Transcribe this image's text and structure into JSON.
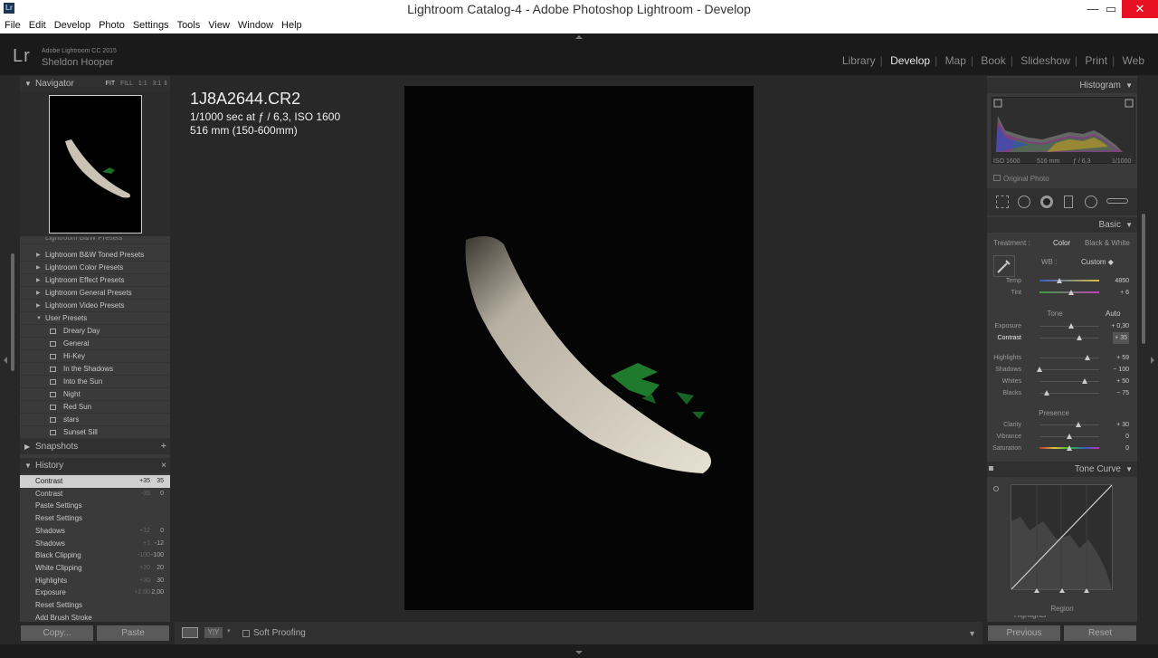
{
  "window": {
    "title": "Lightroom Catalog-4 - Adobe Photoshop Lightroom - Develop",
    "app_icon": "Lr"
  },
  "menu": [
    "File",
    "Edit",
    "Develop",
    "Photo",
    "Settings",
    "Tools",
    "View",
    "Window",
    "Help"
  ],
  "identity": {
    "logo": "Lr",
    "product": "Adobe Lightroom CC 2015",
    "user": "Sheldon Hooper"
  },
  "modules": [
    {
      "label": "Library",
      "active": false
    },
    {
      "label": "Develop",
      "active": true
    },
    {
      "label": "Map",
      "active": false
    },
    {
      "label": "Book",
      "active": false
    },
    {
      "label": "Slideshow",
      "active": false
    },
    {
      "label": "Print",
      "active": false
    },
    {
      "label": "Web",
      "active": false
    }
  ],
  "navigator": {
    "title": "Navigator",
    "options": [
      "FIT",
      "FILL",
      "1:1",
      "3:1"
    ],
    "active_option": "FIT"
  },
  "presets": {
    "cut_top": "Lightroom B&W Presets",
    "folders": [
      "Lightroom B&W Toned Presets",
      "Lightroom Color Presets",
      "Lightroom Effect Presets",
      "Lightroom General Presets",
      "Lightroom Video Presets"
    ],
    "user_folder": "User Presets",
    "user_items": [
      "Dreary Day",
      "General",
      "Hi-Key",
      "In the Shadows",
      "Into the Sun",
      "Night",
      "Red Sun",
      "stars",
      "Sunset Sill"
    ]
  },
  "snapshots": {
    "title": "Snapshots",
    "add": "+"
  },
  "history": {
    "title": "History",
    "close": "×",
    "items": [
      {
        "label": "Contrast",
        "before": "+35",
        "after": "35",
        "selected": true
      },
      {
        "label": "Contrast",
        "before": "-35",
        "after": "0"
      },
      {
        "label": "Paste Settings",
        "before": "",
        "after": ""
      },
      {
        "label": "Reset Settings",
        "before": "",
        "after": ""
      },
      {
        "label": "Shadows",
        "before": "+12",
        "after": "0"
      },
      {
        "label": "Shadows",
        "before": "+1",
        "after": "-12"
      },
      {
        "label": "Black Clipping",
        "before": "-100",
        "after": "-100"
      },
      {
        "label": "White Clipping",
        "before": "+20",
        "after": "20"
      },
      {
        "label": "Highlights",
        "before": "+30",
        "after": "30"
      },
      {
        "label": "Exposure",
        "before": "+2,00",
        "after": "2,00"
      },
      {
        "label": "Reset Settings",
        "before": "",
        "after": ""
      },
      {
        "label": "Add Brush Stroke",
        "before": "",
        "after": ""
      }
    ]
  },
  "left_buttons": {
    "copy": "Copy...",
    "paste": "Paste"
  },
  "photo_info": {
    "filename": "1J8A2644.CR2",
    "exposure": "1/1000 sec at ƒ / 6,3, ISO 1600",
    "lens": "516 mm (150-600mm)"
  },
  "toolbar": {
    "soft_proofing": "Soft Proofing"
  },
  "histogram": {
    "title": "Histogram",
    "iso": "ISO 1600",
    "focal": "516 mm",
    "aperture": "ƒ / 6,3",
    "shutter": "1/1000",
    "original_photo": "Original Photo"
  },
  "basic": {
    "title": "Basic",
    "treatment_label": "Treatment :",
    "treatment_color": "Color",
    "treatment_bw": "Black & White",
    "wb_label": "WB :",
    "wb_value": "Custom",
    "tone_label": "Tone",
    "auto_label": "Auto",
    "presence_label": "Presence",
    "wb_sliders": [
      {
        "label": "Temp",
        "value": "4850",
        "pos": 0.33
      },
      {
        "label": "Tint",
        "value": "+ 6",
        "pos": 0.53
      }
    ],
    "tone_sliders": [
      {
        "label": "Exposure",
        "value": "+ 0,30",
        "pos": 0.53
      },
      {
        "label": "Contrast",
        "value": "+ 35",
        "pos": 0.67,
        "active": true
      }
    ],
    "tone_sliders2": [
      {
        "label": "Highlights",
        "value": "+ 59",
        "pos": 0.8
      },
      {
        "label": "Shadows",
        "value": "− 100",
        "pos": 0.0
      },
      {
        "label": "Whites",
        "value": "+ 50",
        "pos": 0.75
      },
      {
        "label": "Blacks",
        "value": "− 75",
        "pos": 0.12
      }
    ],
    "presence_sliders": [
      {
        "label": "Clarity",
        "value": "+ 30",
        "pos": 0.65
      },
      {
        "label": "Vibrance",
        "value": "0",
        "pos": 0.5
      },
      {
        "label": "Saturation",
        "value": "0",
        "pos": 0.5
      }
    ]
  },
  "tone_curve": {
    "title": "Tone Curve",
    "region": "Region",
    "cut_label": "Highlights"
  },
  "right_buttons": {
    "previous": "Previous",
    "reset": "Reset"
  }
}
